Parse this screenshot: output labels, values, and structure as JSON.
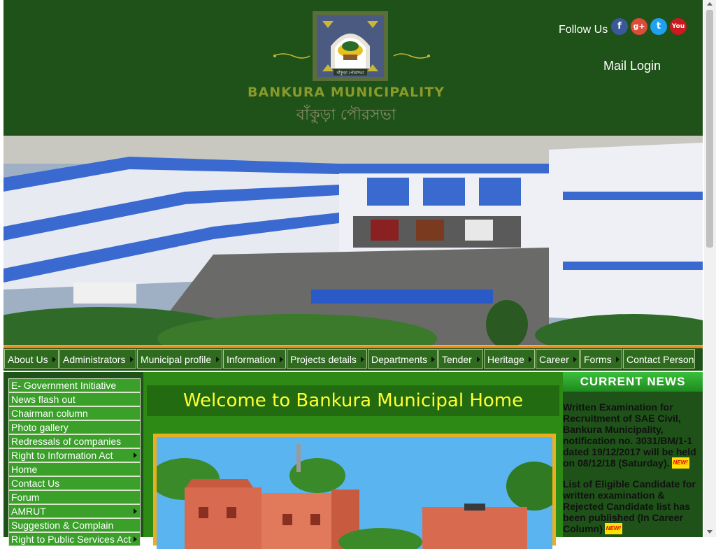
{
  "header": {
    "logo_title": "BANKURA MUNICIPALITY",
    "logo_subtitle": "বাঁকুড়া পৌরসভা",
    "follow_label": "Follow Us",
    "social_icons": [
      "facebook-icon",
      "google-plus-icon",
      "twitter-icon",
      "youtube-icon"
    ],
    "social_glyphs": {
      "facebook": "f",
      "google_plus": "g+",
      "twitter": "t",
      "youtube": "You"
    },
    "mail_login": "Mail Login"
  },
  "nav": {
    "items": [
      {
        "label": "About Us"
      },
      {
        "label": "Administrators"
      },
      {
        "label": "Municipal profile"
      },
      {
        "label": "Information"
      },
      {
        "label": "Projects details"
      },
      {
        "label": "Departments"
      },
      {
        "label": "Tender"
      },
      {
        "label": "Heritage"
      },
      {
        "label": "Career"
      },
      {
        "label": "Forms"
      },
      {
        "label": "Contact Person"
      }
    ]
  },
  "sidebar": {
    "items": [
      {
        "label": "E- Government Initiative"
      },
      {
        "label": "News flash out"
      },
      {
        "label": "Chairman column"
      },
      {
        "label": "Photo gallery"
      },
      {
        "label": "Redressals of companies"
      },
      {
        "label": "Right to Information Act"
      },
      {
        "label": "Home"
      },
      {
        "label": "Contact Us"
      },
      {
        "label": "Forum"
      },
      {
        "label": "AMRUT"
      },
      {
        "label": "Suggestion & Complain"
      },
      {
        "label": "Right to Public Services Act"
      }
    ]
  },
  "main": {
    "welcome": "Welcome to Bankura Municipal Home"
  },
  "news": {
    "heading": "CURRENT NEWS",
    "badge": "NEW!",
    "items": [
      {
        "text": "Written Examination for Recruitment of SAE Civil, Bankura Municipality, notification no. 3031/BM/1-1 dated 19/12/2017 will be held on 08/12/18 (Saturday)."
      },
      {
        "text": "List of Eligible Candidate for written examination & Rejected Candidate list has been published (In Career Column)"
      }
    ]
  },
  "colors": {
    "header_bg": "#1e5218",
    "nav_item_bg": "#2e6b1e",
    "sidebar_item_bg": "#3aa02a",
    "main_bg": "#2d8a14",
    "welcome_text": "#ffff33",
    "accent_line": "#e88a1a"
  }
}
